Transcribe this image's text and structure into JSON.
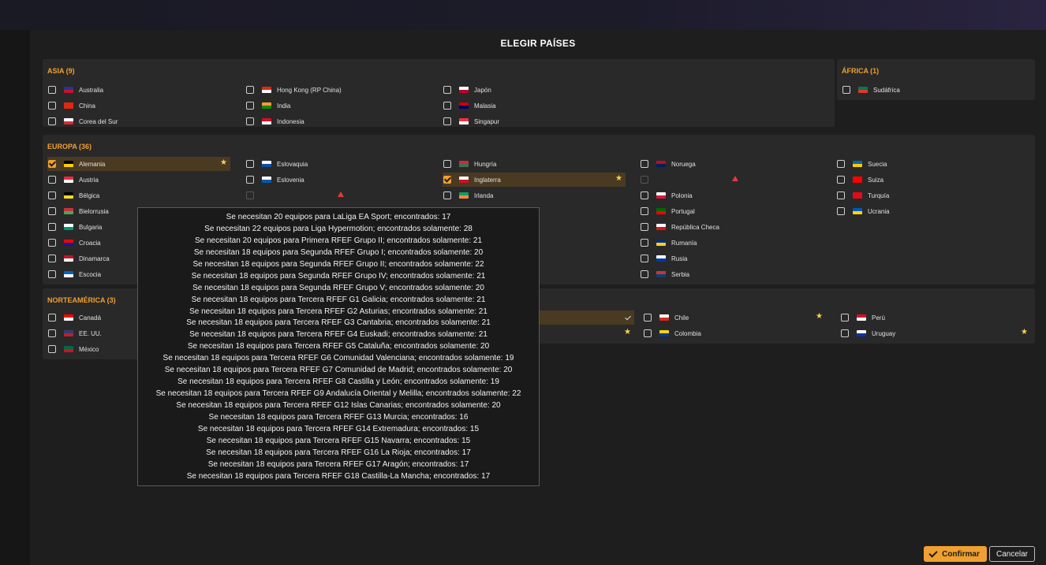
{
  "modal": {
    "title": "ELEGIR PAÍSES"
  },
  "groups": {
    "asia": {
      "title": "ASIA (9)",
      "rows": [
        {
          "label": "Australia",
          "checked": false,
          "flag": [
            "#1c3a8a",
            "#c8102e"
          ]
        },
        {
          "label": "China",
          "checked": false,
          "flag": [
            "#de2910",
            "#de2910"
          ]
        },
        {
          "label": "Corea del Sur",
          "checked": false,
          "flag": [
            "#ffffff",
            "#cd2e3a"
          ]
        },
        {
          "label": "Hong Kong (RP China)",
          "checked": false,
          "flag": [
            "#de2910",
            "#ffffff"
          ]
        },
        {
          "label": "India",
          "checked": false,
          "flag": [
            "#ff9933",
            "#138808"
          ]
        },
        {
          "label": "Indonesia",
          "checked": false,
          "flag": [
            "#ce1126",
            "#ffffff"
          ]
        },
        {
          "label": "Japón",
          "checked": false,
          "flag": [
            "#ffffff",
            "#bc002d"
          ]
        },
        {
          "label": "Malasia",
          "checked": false,
          "flag": [
            "#cc0001",
            "#010066"
          ]
        },
        {
          "label": "Singapur",
          "checked": false,
          "flag": [
            "#ef3340",
            "#ffffff"
          ]
        }
      ]
    },
    "africa": {
      "title": "ÁFRICA (1)",
      "rows": [
        {
          "label": "Sudáfrica",
          "checked": false,
          "flag": [
            "#007a4d",
            "#de3831"
          ]
        }
      ]
    },
    "europa": {
      "title": "EUROPA (36)",
      "rows": [
        {
          "label": "Alemania",
          "checked": true,
          "star": true,
          "flag": [
            "#000000",
            "#ffce00"
          ]
        },
        {
          "label": "Austria",
          "checked": false,
          "flag": [
            "#ed2939",
            "#ffffff"
          ]
        },
        {
          "label": "Bélgica",
          "checked": false,
          "flag": [
            "#000000",
            "#fdda24"
          ]
        },
        {
          "label": "Bielorrusia",
          "checked": false,
          "flag": [
            "#c8313e",
            "#4aa657"
          ]
        },
        {
          "label": "Bulgaria",
          "checked": false,
          "flag": [
            "#ffffff",
            "#00966e"
          ]
        },
        {
          "label": "Croacia",
          "checked": false,
          "flag": [
            "#ff0000",
            "#171796"
          ]
        },
        {
          "label": "Dinamarca",
          "checked": false,
          "flag": [
            "#c8102e",
            "#ffffff"
          ]
        },
        {
          "label": "Escocia",
          "checked": false,
          "flag": [
            "#0065bd",
            "#ffffff"
          ]
        },
        {
          "label": "Eslovaquia",
          "checked": false,
          "flag": [
            "#ffffff",
            "#0b4ea2"
          ]
        },
        {
          "label": "Eslovenia",
          "checked": false,
          "flag": [
            "#ffffff",
            "#005da4"
          ]
        },
        {
          "label": "Hungría",
          "checked": false,
          "flag": [
            "#cd2a3e",
            "#436f4d"
          ]
        },
        {
          "label": "Inglaterra",
          "checked": true,
          "star": true,
          "flag": [
            "#ffffff",
            "#ce1124"
          ]
        },
        {
          "label": "Irlanda",
          "checked": false,
          "flag": [
            "#169b62",
            "#ff883e"
          ]
        },
        {
          "label": "Noruega",
          "checked": false,
          "flag": [
            "#ba0c2f",
            "#00205b"
          ]
        },
        {
          "label": "Polonia",
          "checked": false,
          "flag": [
            "#ffffff",
            "#dc143c"
          ]
        },
        {
          "label": "Portugal",
          "checked": false,
          "flag": [
            "#006600",
            "#ff0000"
          ]
        },
        {
          "label": "República Checa",
          "checked": false,
          "flag": [
            "#ffffff",
            "#d7141a"
          ]
        },
        {
          "label": "Rumanía",
          "checked": false,
          "flag": [
            "#002b7f",
            "#fcd116"
          ]
        },
        {
          "label": "Rusia",
          "checked": false,
          "flag": [
            "#ffffff",
            "#0039a6"
          ]
        },
        {
          "label": "Serbia",
          "checked": false,
          "flag": [
            "#c6363c",
            "#0c4076"
          ]
        },
        {
          "label": "Suecia",
          "checked": false,
          "flag": [
            "#006aa7",
            "#fecc00"
          ]
        },
        {
          "label": "Suiza",
          "checked": false,
          "flag": [
            "#ff0000",
            "#ff0000"
          ]
        },
        {
          "label": "Turquía",
          "checked": false,
          "flag": [
            "#e30a17",
            "#e30a17"
          ]
        },
        {
          "label": "Ucrania",
          "checked": false,
          "flag": [
            "#0057b7",
            "#ffd700"
          ]
        }
      ]
    },
    "norteamerica": {
      "title": "NORTEAMÉRICA (3)",
      "rows": [
        {
          "label": "Canadá",
          "checked": false,
          "flag": [
            "#ff0000",
            "#ffffff"
          ]
        },
        {
          "label": "EE. UU.",
          "checked": false,
          "flag": [
            "#3c3b6e",
            "#b22234"
          ]
        },
        {
          "label": "México",
          "checked": false,
          "flag": [
            "#006847",
            "#ce1126"
          ]
        }
      ]
    },
    "sudamerica": {
      "rows": [
        {
          "label": "Chile",
          "checked": false,
          "star": true,
          "flag": [
            "#ffffff",
            "#d52b1e"
          ]
        },
        {
          "label": "Colombia",
          "checked": false,
          "flag": [
            "#fcd116",
            "#003893"
          ]
        },
        {
          "label": "Perú",
          "checked": false,
          "flag": [
            "#d91023",
            "#ffffff"
          ]
        },
        {
          "label": "Uruguay",
          "checked": false,
          "star": true,
          "flag": [
            "#ffffff",
            "#0038a8"
          ]
        }
      ]
    }
  },
  "tooltip": {
    "lines": [
      "Se necesitan 20 equipos para LaLiga EA Sport; encontrados: 17",
      "Se necesitan 22 equipos para Liga  Hypermotion; encontrados solamente: 28",
      "Se necesitan 20 equipos para Primera RFEF Grupo II; encontrados solamente: 21",
      "Se necesitan 18 equipos para Segunda RFEF Grupo I; encontrados solamente: 20",
      "Se necesitan 18 equipos para Segunda RFEF Grupo II; encontrados solamente: 22",
      "Se necesitan 18 equipos para Segunda RFEF Grupo IV; encontrados solamente: 21",
      "Se necesitan 18 equipos para Segunda RFEF Grupo V; encontrados solamente: 20",
      "Se necesitan 18 equipos para Tercera RFEF G1 Galicia; encontrados solamente: 21",
      "Se necesitan 18 equipos para Tercera RFEF G2 Asturias; encontrados solamente: 21",
      "Se necesitan 18 equipos para Tercera RFEF G3 Cantabria; encontrados solamente: 21",
      "Se necesitan 18 equipos para Tercera RFEF G4 Euskadi; encontrados solamente: 21",
      "Se necesitan 18 equipos para Tercera RFEF G5 Cataluña; encontrados solamente: 20",
      "Se necesitan 18 equipos para Tercera RFEF G6 Comunidad Valenciana; encontrados solamente: 19",
      "Se necesitan 18 equipos para Tercera RFEF G7 Comunidad de Madrid; encontrados solamente: 20",
      "Se necesitan 18 equipos para Tercera RFEF G8 Castilla y León; encontrados solamente: 19",
      "Se necesitan 18 equipos para Tercera RFEF G9 Andalucía Oriental y Melilla; encontrados solamente: 22",
      "Se necesitan 18 equipos para Tercera RFEF G12 Islas Canarias; encontrados solamente: 20",
      "Se necesitan 18 equipos para Tercera RFEF G13 Murcia; encontrados: 16",
      "Se necesitan 18 equipos para Tercera RFEF G14 Extremadura; encontrados: 15",
      "Se necesitan 18 equipos para Tercera RFEF G15 Navarra; encontrados: 15",
      "Se necesitan 18 equipos para Tercera RFEF G16 La Rioja; encontrados: 17",
      "Se necesitan 18 equipos para Tercera RFEF G17 Aragón; encontrados: 17",
      "Se necesitan 18 equipos para Tercera RFEF G18 Castilla-La Mancha; encontrados: 17"
    ]
  },
  "buttons": {
    "confirm_label": "Confirmar",
    "cancel_label": "Cancelar"
  },
  "colors": {
    "accent": "#f0a030",
    "warning": "#e23b3b",
    "star": "#ffd24a"
  },
  "icons": {
    "star": "star-icon",
    "warning": "warning-icon",
    "check": "check-icon"
  }
}
